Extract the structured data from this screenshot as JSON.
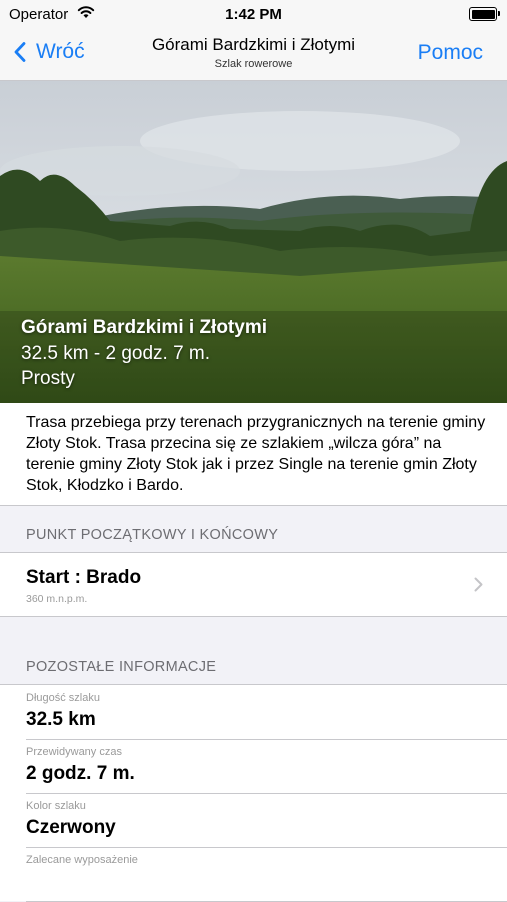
{
  "status_bar": {
    "carrier": "Operator",
    "time": "1:42 PM"
  },
  "nav": {
    "back_label": "Wróć",
    "title": "Górami Bardzkimi i Złotymi",
    "subtitle": "Szlak rowerowe",
    "help_label": "Pomoc",
    "accent_color": "#1a7ef5"
  },
  "hero": {
    "title": "Górami Bardzkimi i Złotymi",
    "distance_time": "32.5 km - 2 godz. 7 m.",
    "level": "Prosty"
  },
  "description": "Trasa przebiega przy terenach przygranicznych na terenie gminy Złoty Stok. Trasa przecina się ze szlakiem „wilcza góra” na terenie gminy Złoty Stok jak i przez Single na terenie gmin Złoty Stok, Kłodzko i Bardo.",
  "start_section": {
    "header": "PUNKT POCZĄTKOWY I KOŃCOWY",
    "start_label": "Start : Brado",
    "elevation": "360 m.n.p.m."
  },
  "info_section": {
    "header": "POZOSTAŁE INFORMACJE",
    "rows": [
      {
        "label": "Długość szlaku",
        "value": "32.5 km"
      },
      {
        "label": "Przewidywany czas",
        "value": "2 godz. 7 m."
      },
      {
        "label": "Kolor szlaku",
        "value": "Czerwony"
      },
      {
        "label": "Zalecane wyposażenie",
        "value": ""
      }
    ]
  }
}
